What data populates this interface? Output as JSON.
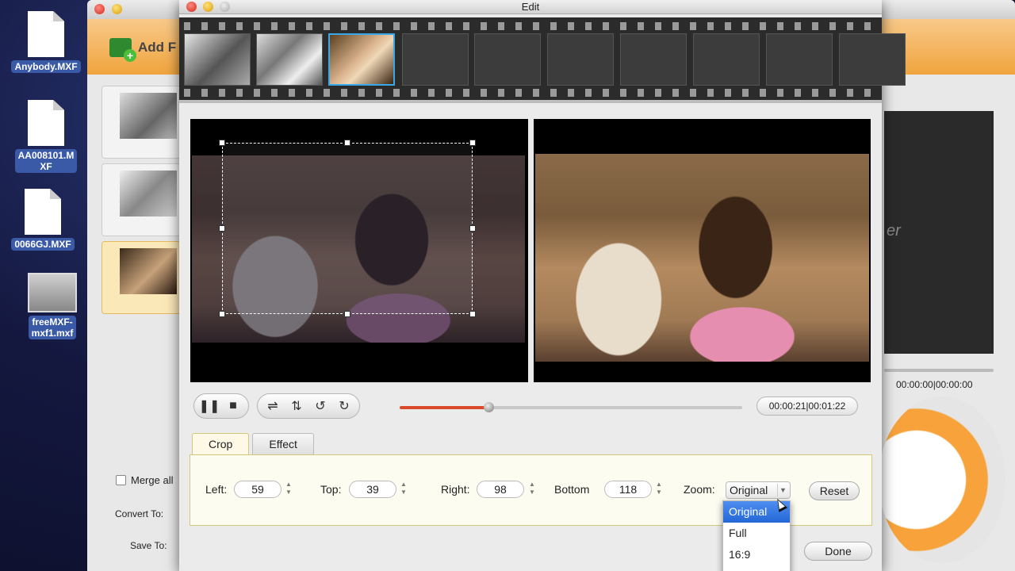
{
  "desktop": {
    "icons": [
      {
        "label": "Anybody.MXF"
      },
      {
        "label_line1": "AA008101.M",
        "label_line2": "XF"
      },
      {
        "label": "0066GJ.MXF"
      },
      {
        "label_line1": "freeMXF-",
        "label_line2": "mxf1.mxf"
      }
    ]
  },
  "main_app": {
    "add_button_label": "Add F",
    "merge_label": "Merge all",
    "convert_to_label": "Convert To:",
    "save_to_label": "Save To:",
    "preview_fragment": "er",
    "preview_time": "00:00:00|00:00:00"
  },
  "edit_window": {
    "title": "Edit",
    "playback_time": "00:00:21|00:01:22",
    "progress_fraction": 0.26,
    "tabs": [
      "Crop",
      "Effect"
    ],
    "active_tab": "Crop",
    "crop": {
      "left_label": "Left:",
      "left_value": "59",
      "top_label": "Top:",
      "top_value": "39",
      "right_label": "Right:",
      "right_value": "98",
      "bottom_label": "Bottom",
      "bottom_value": "118",
      "zoom_label": "Zoom:",
      "zoom_value": "Original"
    },
    "reset_label": "Reset",
    "done_label": "Done",
    "zoom_options": [
      "Original",
      "Full",
      "16:9"
    ],
    "zoom_highlighted": "Original",
    "accent_color": "#3aa7e8",
    "seek_color": "#d94a2a"
  }
}
